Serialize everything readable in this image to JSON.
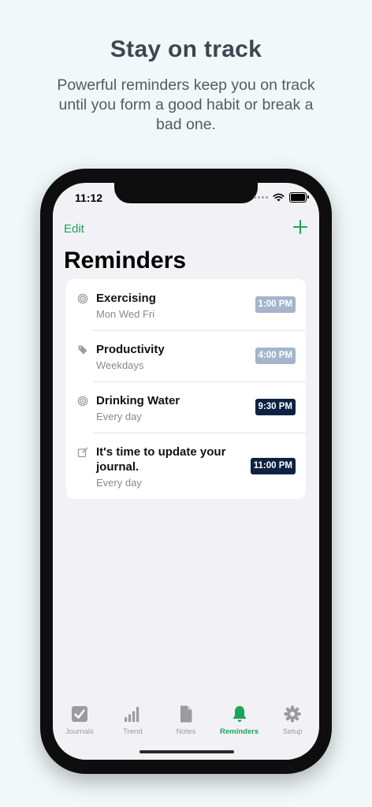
{
  "hero": {
    "title": "Stay on track",
    "subtitle": "Powerful reminders keep you on track until you form a good habit or break a bad one."
  },
  "status_bar": {
    "time": "11:12"
  },
  "nav": {
    "edit_label": "Edit",
    "add_icon": "plus-icon"
  },
  "page_title": "Reminders",
  "colors": {
    "accent": "#1ca35b",
    "badge_light": "#a4b5cc",
    "badge_dark": "#0d2142",
    "icon_gray": "#9a9ca0"
  },
  "reminders": [
    {
      "title": "Exercising",
      "schedule": "Mon Wed Fri",
      "time": "1:00 PM",
      "icon": "target-icon",
      "badge_style": "light"
    },
    {
      "title": "Productivity",
      "schedule": "Weekdays",
      "time": "4:00 PM",
      "icon": "tag-icon",
      "badge_style": "light"
    },
    {
      "title": "Drinking Water",
      "schedule": "Every day",
      "time": "9:30 PM",
      "icon": "target-icon",
      "badge_style": "dark"
    },
    {
      "title": "It's time to update your journal.",
      "schedule": "Every day",
      "time": "11:00 PM",
      "icon": "journal-edit-icon",
      "badge_style": "dark"
    }
  ],
  "tabs": [
    {
      "label": "Journals",
      "icon": "checkbox-icon",
      "active": false
    },
    {
      "label": "Trend",
      "icon": "bar-chart-icon",
      "active": false
    },
    {
      "label": "Notes",
      "icon": "document-icon",
      "active": false
    },
    {
      "label": "Reminders",
      "icon": "bell-icon",
      "active": true
    },
    {
      "label": "Setup",
      "icon": "gear-icon",
      "active": false
    }
  ]
}
